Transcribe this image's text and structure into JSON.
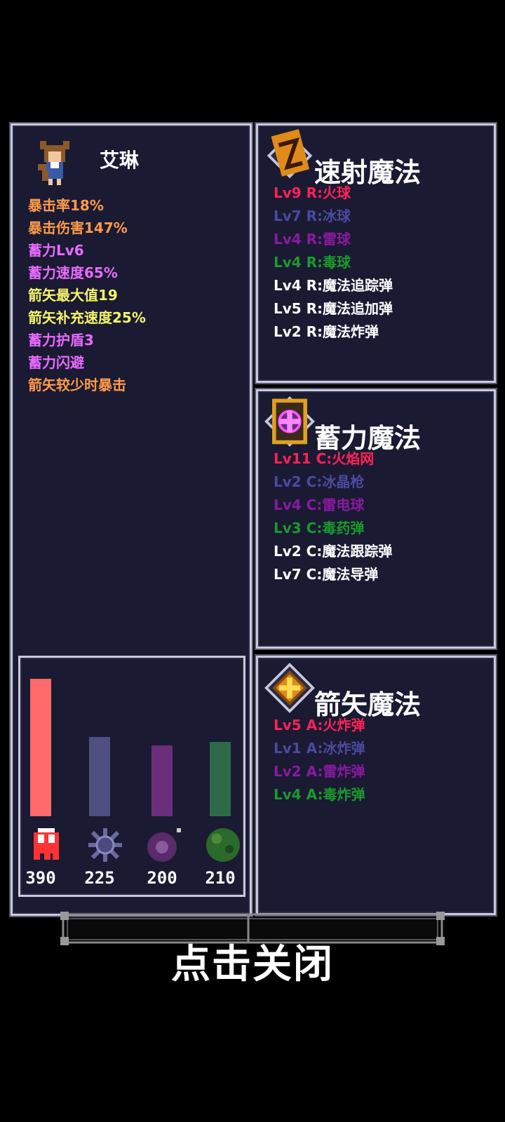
{
  "colors": {
    "orange": "#ff9a4a",
    "magenta": "#e96bff",
    "yellow": "#f5f56a",
    "fire": "#ff2255",
    "ice": "#4a4aa0",
    "thunder": "#8a1aa0",
    "poison": "#1a9a2a",
    "white": "#ffffff"
  },
  "character": {
    "name": "艾琳",
    "stats": [
      {
        "text": "暴击率18%",
        "color": "#ff9a4a"
      },
      {
        "text": "暴击伤害147%",
        "color": "#ff9a4a"
      },
      {
        "text": "蓄力Lv6",
        "color": "#e96bff"
      },
      {
        "text": "蓄力速度65%",
        "color": "#e96bff"
      },
      {
        "text": "箭矢最大值19",
        "color": "#f5f56a"
      },
      {
        "text": "箭矢补充速度25%",
        "color": "#f5f56a"
      },
      {
        "text": "蓄力护盾3",
        "color": "#e96bff"
      },
      {
        "text": "蓄力闪避",
        "color": "#e96bff"
      },
      {
        "text": "箭矢较少时暴击",
        "color": "#ff9a4a"
      }
    ]
  },
  "damage": {
    "max": 390,
    "items": [
      {
        "value": "390",
        "amount": 390,
        "color": "#ff6b6b",
        "icon": "fire-spirit-icon"
      },
      {
        "value": "225",
        "amount": 225,
        "color": "#4f4f80",
        "icon": "ice-crystal-icon"
      },
      {
        "value": "200",
        "amount": 200,
        "color": "#6a2e7a",
        "icon": "thunder-orb-icon"
      },
      {
        "value": "210",
        "amount": 210,
        "color": "#2e6a4a",
        "icon": "poison-orb-icon"
      }
    ]
  },
  "magic": {
    "rapid": {
      "title": "速射魔法",
      "spells": [
        {
          "text": "Lv9 R:火球",
          "color": "#ff2255"
        },
        {
          "text": "Lv7 R:冰球",
          "color": "#4a4aa0"
        },
        {
          "text": "Lv4 R:雷球",
          "color": "#8a1aa0"
        },
        {
          "text": "Lv4 R:毒球",
          "color": "#1a9a2a"
        },
        {
          "text": "Lv4 R:魔法追踪弹",
          "color": "#ffffff"
        },
        {
          "text": "Lv5 R:魔法追加弹",
          "color": "#ffffff"
        },
        {
          "text": "Lv2 R:魔法炸弹",
          "color": "#ffffff"
        }
      ]
    },
    "charge": {
      "title": "蓄力魔法",
      "spells": [
        {
          "text": "Lv11 C:火焰网",
          "color": "#ff2255"
        },
        {
          "text": "Lv2 C:冰晶枪",
          "color": "#4a4aa0"
        },
        {
          "text": "Lv4 C:雷电球",
          "color": "#8a1aa0"
        },
        {
          "text": "Lv3 C:毒药弹",
          "color": "#1a9a2a"
        },
        {
          "text": "Lv2 C:魔法跟踪弹",
          "color": "#ffffff"
        },
        {
          "text": "Lv7 C:魔法导弹",
          "color": "#ffffff"
        }
      ]
    },
    "arrow": {
      "title": "箭矢魔法",
      "spells": [
        {
          "text": "Lv5 A:火炸弹",
          "color": "#ff2255"
        },
        {
          "text": "Lv1 A:冰炸弹",
          "color": "#4a4aa0"
        },
        {
          "text": "Lv2 A:雷炸弹",
          "color": "#8a1aa0"
        },
        {
          "text": "Lv4 A:毒炸弹",
          "color": "#1a9a2a"
        }
      ]
    }
  },
  "close_label": "点击关闭"
}
